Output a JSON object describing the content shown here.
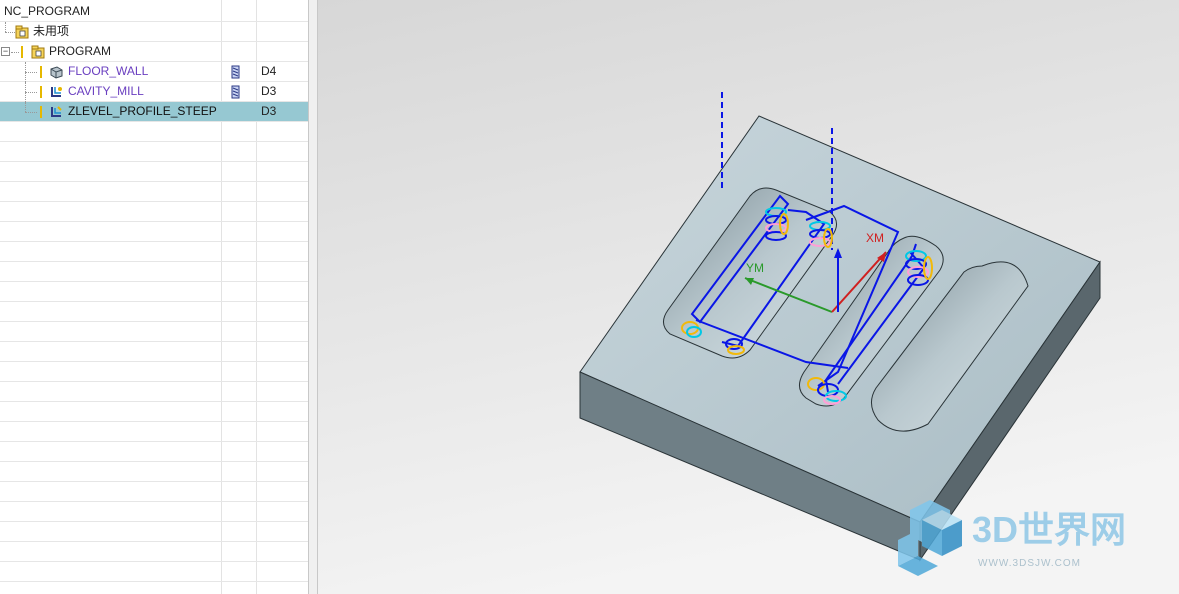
{
  "navigator": {
    "root_label": "NC_PROGRAM",
    "unused_label": "未用项",
    "program_label": "PROGRAM",
    "operations": [
      {
        "name": "FLOOR_WALL",
        "tool": "D4",
        "icon": "floor-wall-operation-icon"
      },
      {
        "name": "CAVITY_MILL",
        "tool": "D3",
        "icon": "cavity-mill-operation-icon"
      },
      {
        "name": "ZLEVEL_PROFILE_STEEP",
        "tool": "D3",
        "icon": "zlevel-profile-operation-icon",
        "selected": true
      }
    ]
  },
  "viewport": {
    "axes": {
      "x_label": "XM",
      "y_label": "YM"
    },
    "colors": {
      "part_top": "#b4c6cc",
      "part_side": "#6f7f86",
      "toolpath": "#0a16e6",
      "x_axis": "#d02020",
      "y_axis": "#2a9a2a"
    }
  },
  "watermark": {
    "brand": "3D世界网",
    "url": "WWW.3DSJW.COM"
  }
}
